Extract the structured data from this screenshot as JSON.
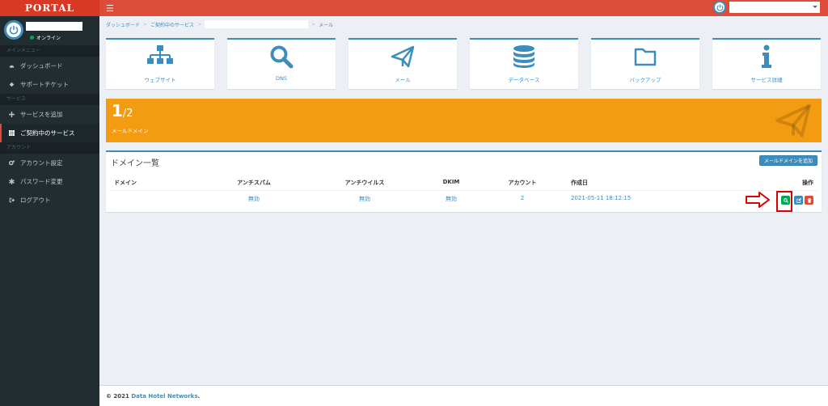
{
  "app": {
    "logo_text": "PORTAL",
    "menu_icon": "hamburger-icon"
  },
  "colors": {
    "header": "#dd4b39",
    "logo_bg": "#d73925",
    "sidebar": "#222d32",
    "accent": "#3c8dbc",
    "orange": "#f39c12",
    "green": "#00a65a",
    "red": "#dd4b39"
  },
  "user": {
    "status": "オンライン"
  },
  "sidebar": {
    "sections": [
      {
        "header": "メインメニュー",
        "items": [
          {
            "label": "ダッシュボード",
            "icon": "dashboard-icon"
          },
          {
            "label": "サポートチケット",
            "icon": "ticket-icon"
          }
        ]
      },
      {
        "header": "サービス",
        "items": [
          {
            "label": "サービスを追加",
            "icon": "plus-icon"
          },
          {
            "label": "ご契約中のサービス",
            "icon": "grid-icon",
            "active": true
          }
        ]
      },
      {
        "header": "アカウント",
        "items": [
          {
            "label": "アカウント設定",
            "icon": "cogs-icon"
          },
          {
            "label": "パスワード変更",
            "icon": "asterisk-icon"
          },
          {
            "label": "ログアウト",
            "icon": "sign-out-icon"
          }
        ]
      }
    ]
  },
  "breadcrumb": {
    "items": [
      "ダッシュボード",
      "ご契約中のサービス"
    ],
    "current": "メール"
  },
  "services": [
    {
      "label": "ウェブサイト",
      "icon": "sitemap-icon"
    },
    {
      "label": "DNS",
      "icon": "search-icon"
    },
    {
      "label": "メール",
      "icon": "paper-plane-icon"
    },
    {
      "label": "データベース",
      "icon": "database-icon"
    },
    {
      "label": "バックアップ",
      "icon": "folder-icon"
    },
    {
      "label": "サービス詳細",
      "icon": "info-icon"
    }
  ],
  "stat": {
    "current": "1",
    "total": "/2",
    "label": "メールドメイン",
    "icon": "paper-plane-icon"
  },
  "domain_list": {
    "title": "ドメイン一覧",
    "add_button": "メールドメインを追加",
    "headers": {
      "domain": "ドメイン",
      "antispam": "アンチスパム",
      "antivirus": "アンチウイルス",
      "dkim": "DKIM",
      "accounts": "アカウント",
      "created": "作成日",
      "actions": "操作"
    },
    "rows": [
      {
        "domain": "",
        "antispam": "無効",
        "antivirus": "無効",
        "dkim": "無効",
        "accounts": "2",
        "created": "2021-05-11 18:12:15"
      }
    ],
    "action_icons": [
      "search-icon",
      "edit-icon",
      "trash-icon"
    ]
  },
  "footer": {
    "copyright": "© 2021",
    "brand": "Data Hotel Networks",
    "suffix": "."
  }
}
